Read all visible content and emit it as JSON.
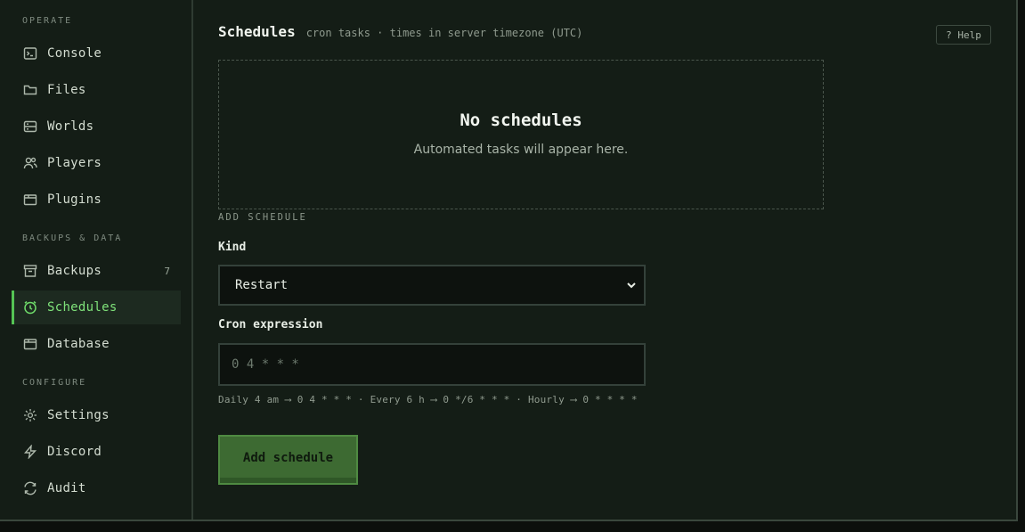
{
  "sidebar": {
    "sections": [
      {
        "title": "OPERATE"
      },
      {
        "title": "BACKUPS & DATA"
      },
      {
        "title": "CONFIGURE"
      }
    ],
    "items": [
      {
        "label": "Console",
        "icon": "terminal-icon"
      },
      {
        "label": "Files",
        "icon": "folder-icon"
      },
      {
        "label": "Worlds",
        "icon": "server-icon"
      },
      {
        "label": "Players",
        "icon": "users-icon"
      },
      {
        "label": "Plugins",
        "icon": "package-icon"
      },
      {
        "label": "Backups",
        "icon": "archive-icon",
        "count": "7"
      },
      {
        "label": "Schedules",
        "icon": "clock-icon",
        "active": true
      },
      {
        "label": "Database",
        "icon": "database-icon"
      },
      {
        "label": "Settings",
        "icon": "gear-icon"
      },
      {
        "label": "Discord",
        "icon": "bolt-icon"
      },
      {
        "label": "Audit",
        "icon": "refresh-icon"
      }
    ]
  },
  "header": {
    "title": "Schedules",
    "subtitle": "cron tasks · times in server timezone (UTC)",
    "help_label": "? Help"
  },
  "empty_state": {
    "title": "No schedules",
    "message": "Automated tasks will appear here."
  },
  "form": {
    "section_label": "ADD SCHEDULE",
    "kind_label": "Kind",
    "kind_value": "Restart",
    "cron_label": "Cron expression",
    "cron_placeholder": "0 4 * * *",
    "cron_value": "",
    "hint": "Daily 4 am ⟶ 0 4 * * * · Every 6 h ⟶ 0 */6 * * * · Hourly ⟶ 0 * * * *",
    "submit_label": "Add schedule"
  },
  "colors": {
    "accent": "#55c454",
    "background": "#141d16",
    "button": "#3d6a32"
  }
}
